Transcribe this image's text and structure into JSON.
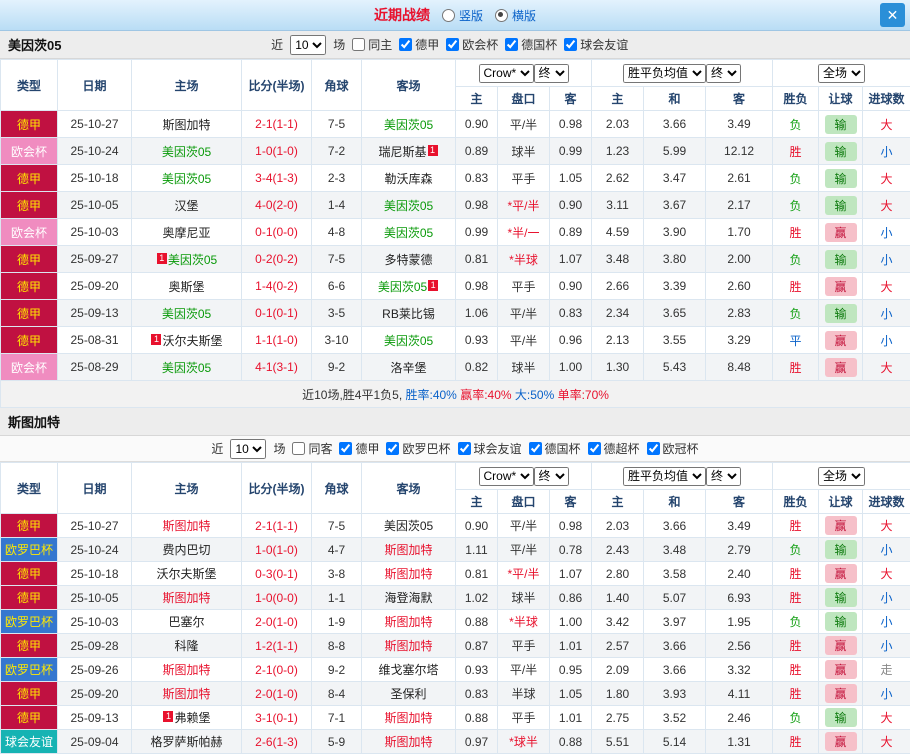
{
  "palette": {
    "title_red": "#e8112d",
    "link_blue": "#0a62c9",
    "team_green": "#0a9a0a",
    "team_red": "#e8112d",
    "league_bundesliga_bg": "#c01141",
    "league_conference_bg": "#f08cc0",
    "league_europa_bg": "#3577cf",
    "league_friendly_bg": "#16b3b3",
    "win_pill_bg": "#f6c0c9",
    "lose_pill_bg": "#bfe6bf",
    "titlebar_bg": "#b9ddf5",
    "close_btn_bg": "#2a8fd8"
  },
  "titlebar": {
    "title": "近期战绩",
    "radios": [
      {
        "label": "竖版",
        "checked": false
      },
      {
        "label": "横版",
        "checked": true
      }
    ],
    "close_glyph": "✕"
  },
  "table_header": {
    "left": [
      "类型",
      "日期",
      "主场",
      "比分(半场)",
      "角球",
      "客场"
    ],
    "odds_source": "Crow*",
    "final": "终",
    "avg_label": "胜平负均值",
    "scope": "全场",
    "sub": [
      "主",
      "盘口",
      "客",
      "主",
      "和",
      "客",
      "胜负",
      "让球",
      "进球数"
    ]
  },
  "sections": [
    {
      "team": "美因茨05",
      "filters_inline": true,
      "filters": {
        "near": "近",
        "count": "10",
        "unit": "场",
        "same": "同主",
        "same_checked": false,
        "leagues": [
          "德甲",
          "欧会杯",
          "德国杯",
          "球会友谊"
        ]
      },
      "rows": [
        {
          "lg": "德甲",
          "lgc": "dj",
          "date": "25-10-27",
          "home": {
            "name": "斯图加特"
          },
          "score": "2-1(1-1)",
          "corner": "7-5",
          "away": {
            "name": "美因茨05",
            "color": "green"
          },
          "oh": "0.90",
          "line": "平/半",
          "oa": "0.98",
          "eh": "2.03",
          "ed": "3.66",
          "ea": "3.49",
          "res": "负",
          "resc": "green",
          "let": "输",
          "letc": "lose",
          "goal": "大",
          "goalc": "red"
        },
        {
          "lg": "欧会杯",
          "lgc": "oh",
          "date": "25-10-24",
          "home": {
            "name": "美因茨05",
            "color": "green"
          },
          "score": "1-0(1-0)",
          "corner": "7-2",
          "away": {
            "name": "瑞尼斯基",
            "badge": "after",
            "badge_n": "1"
          },
          "oh": "0.89",
          "line": "球半",
          "oa": "0.99",
          "eh": "1.23",
          "ed": "5.99",
          "ea": "12.12",
          "res": "胜",
          "resc": "red",
          "let": "输",
          "letc": "lose",
          "goal": "小",
          "goalc": "blue"
        },
        {
          "lg": "德甲",
          "lgc": "dj",
          "date": "25-10-18",
          "home": {
            "name": "美因茨05",
            "color": "green"
          },
          "score": "3-4(1-3)",
          "corner": "2-3",
          "away": {
            "name": "勒沃库森"
          },
          "oh": "0.83",
          "line": "平手",
          "oa": "1.05",
          "eh": "2.62",
          "ed": "3.47",
          "ea": "2.61",
          "res": "负",
          "resc": "green",
          "let": "输",
          "letc": "lose",
          "goal": "大",
          "goalc": "red"
        },
        {
          "lg": "德甲",
          "lgc": "dj",
          "date": "25-10-05",
          "home": {
            "name": "汉堡"
          },
          "score": "4-0(2-0)",
          "corner": "1-4",
          "away": {
            "name": "美因茨05",
            "color": "green"
          },
          "oh": "0.98",
          "line": "*平/半",
          "lineRed": true,
          "oa": "0.90",
          "eh": "3.11",
          "ed": "3.67",
          "ea": "2.17",
          "res": "负",
          "resc": "green",
          "let": "输",
          "letc": "lose",
          "goal": "大",
          "goalc": "red"
        },
        {
          "lg": "欧会杯",
          "lgc": "oh",
          "date": "25-10-03",
          "home": {
            "name": "奥摩尼亚"
          },
          "score": "0-1(0-0)",
          "corner": "4-8",
          "away": {
            "name": "美因茨05",
            "color": "green"
          },
          "oh": "0.99",
          "line": "*半/一",
          "lineRed": true,
          "oa": "0.89",
          "eh": "4.59",
          "ed": "3.90",
          "ea": "1.70",
          "res": "胜",
          "resc": "red",
          "let": "赢",
          "letc": "win",
          "goal": "小",
          "goalc": "blue"
        },
        {
          "lg": "德甲",
          "lgc": "dj",
          "date": "25-09-27",
          "home": {
            "name": "美因茨05",
            "color": "green",
            "badge": "before",
            "badge_n": "1"
          },
          "score": "0-2(0-2)",
          "corner": "7-5",
          "away": {
            "name": "多特蒙德"
          },
          "oh": "0.81",
          "line": "*半球",
          "lineRed": true,
          "oa": "1.07",
          "eh": "3.48",
          "ed": "3.80",
          "ea": "2.00",
          "res": "负",
          "resc": "green",
          "let": "输",
          "letc": "lose",
          "goal": "小",
          "goalc": "blue"
        },
        {
          "lg": "德甲",
          "lgc": "dj",
          "date": "25-09-20",
          "home": {
            "name": "奥斯堡"
          },
          "score": "1-4(0-2)",
          "corner": "6-6",
          "away": {
            "name": "美因茨05",
            "color": "green",
            "badge": "after",
            "badge_n": "1"
          },
          "oh": "0.98",
          "line": "平手",
          "oa": "0.90",
          "eh": "2.66",
          "ed": "3.39",
          "ea": "2.60",
          "res": "胜",
          "resc": "red",
          "let": "赢",
          "letc": "win",
          "goal": "大",
          "goalc": "red"
        },
        {
          "lg": "德甲",
          "lgc": "dj",
          "date": "25-09-13",
          "home": {
            "name": "美因茨05",
            "color": "green"
          },
          "score": "0-1(0-1)",
          "corner": "3-5",
          "away": {
            "name": "RB莱比锡"
          },
          "oh": "1.06",
          "line": "平/半",
          "oa": "0.83",
          "eh": "2.34",
          "ed": "3.65",
          "ea": "2.83",
          "res": "负",
          "resc": "green",
          "let": "输",
          "letc": "lose",
          "goal": "小",
          "goalc": "blue"
        },
        {
          "lg": "德甲",
          "lgc": "dj",
          "date": "25-08-31",
          "home": {
            "name": "沃尔夫斯堡",
            "badge": "before",
            "badge_n": "1"
          },
          "score": "1-1(1-0)",
          "corner": "3-10",
          "away": {
            "name": "美因茨05",
            "color": "green"
          },
          "oh": "0.93",
          "line": "平/半",
          "oa": "0.96",
          "eh": "2.13",
          "ed": "3.55",
          "ea": "3.29",
          "res": "平",
          "resc": "blue",
          "let": "赢",
          "letc": "win",
          "goal": "小",
          "goalc": "blue"
        },
        {
          "lg": "欧会杯",
          "lgc": "oh",
          "date": "25-08-29",
          "home": {
            "name": "美因茨05",
            "color": "green"
          },
          "score": "4-1(3-1)",
          "corner": "9-2",
          "away": {
            "name": "洛辛堡"
          },
          "oh": "0.82",
          "line": "球半",
          "oa": "1.00",
          "eh": "1.30",
          "ed": "5.43",
          "ea": "8.48",
          "res": "胜",
          "resc": "red",
          "let": "赢",
          "letc": "win",
          "goal": "大",
          "goalc": "red"
        }
      ],
      "summary": [
        {
          "text": "近10场,胜4平1负5, ",
          "cls": "s-plain"
        },
        {
          "text": "胜率:40%",
          "cls": "s-blue"
        },
        {
          "text": " 赢率:40%",
          "cls": "s-red"
        },
        {
          "text": " 大:50%",
          "cls": "s-blue"
        },
        {
          "text": " 单率:70%",
          "cls": "s-red"
        }
      ]
    },
    {
      "team": "斯图加特",
      "filters_inline": false,
      "filters": {
        "near": "近",
        "count": "10",
        "unit": "场",
        "same": "同客",
        "same_checked": false,
        "leagues": [
          "德甲",
          "欧罗巴杯",
          "球会友谊",
          "德国杯",
          "德超杯",
          "欧冠杯"
        ]
      },
      "rows": [
        {
          "lg": "德甲",
          "lgc": "dj",
          "date": "25-10-27",
          "home": {
            "name": "斯图加特",
            "color": "red"
          },
          "score": "2-1(1-1)",
          "corner": "7-5",
          "away": {
            "name": "美因茨05"
          },
          "oh": "0.90",
          "line": "平/半",
          "oa": "0.98",
          "eh": "2.03",
          "ed": "3.66",
          "ea": "3.49",
          "res": "胜",
          "resc": "red",
          "let": "赢",
          "letc": "win",
          "goal": "大",
          "goalc": "red"
        },
        {
          "lg": "欧罗巴杯",
          "lgc": "ol",
          "date": "25-10-24",
          "home": {
            "name": "费内巴切"
          },
          "score": "1-0(1-0)",
          "corner": "4-7",
          "away": {
            "name": "斯图加特",
            "color": "red"
          },
          "oh": "1.11",
          "line": "平/半",
          "oa": "0.78",
          "eh": "2.43",
          "ed": "3.48",
          "ea": "2.79",
          "res": "负",
          "resc": "green",
          "let": "输",
          "letc": "lose",
          "goal": "小",
          "goalc": "blue"
        },
        {
          "lg": "德甲",
          "lgc": "dj",
          "date": "25-10-18",
          "home": {
            "name": "沃尔夫斯堡"
          },
          "score": "0-3(0-1)",
          "corner": "3-8",
          "away": {
            "name": "斯图加特",
            "color": "red"
          },
          "oh": "0.81",
          "line": "*平/半",
          "lineRed": true,
          "oa": "1.07",
          "eh": "2.80",
          "ed": "3.58",
          "ea": "2.40",
          "res": "胜",
          "resc": "red",
          "let": "赢",
          "letc": "win",
          "goal": "大",
          "goalc": "red"
        },
        {
          "lg": "德甲",
          "lgc": "dj",
          "date": "25-10-05",
          "home": {
            "name": "斯图加特",
            "color": "red"
          },
          "score": "1-0(0-0)",
          "corner": "1-1",
          "away": {
            "name": "海登海默"
          },
          "oh": "1.02",
          "line": "球半",
          "oa": "0.86",
          "eh": "1.40",
          "ed": "5.07",
          "ea": "6.93",
          "res": "胜",
          "resc": "red",
          "let": "输",
          "letc": "lose",
          "goal": "小",
          "goalc": "blue"
        },
        {
          "lg": "欧罗巴杯",
          "lgc": "ol",
          "date": "25-10-03",
          "home": {
            "name": "巴塞尔"
          },
          "score": "2-0(1-0)",
          "corner": "1-9",
          "away": {
            "name": "斯图加特",
            "color": "red"
          },
          "oh": "0.88",
          "line": "*半球",
          "lineRed": true,
          "oa": "1.00",
          "eh": "3.42",
          "ed": "3.97",
          "ea": "1.95",
          "res": "负",
          "resc": "green",
          "let": "输",
          "letc": "lose",
          "goal": "小",
          "goalc": "blue"
        },
        {
          "lg": "德甲",
          "lgc": "dj",
          "date": "25-09-28",
          "home": {
            "name": "科隆"
          },
          "score": "1-2(1-1)",
          "corner": "8-8",
          "away": {
            "name": "斯图加特",
            "color": "red"
          },
          "oh": "0.87",
          "line": "平手",
          "oa": "1.01",
          "eh": "2.57",
          "ed": "3.66",
          "ea": "2.56",
          "res": "胜",
          "resc": "red",
          "let": "赢",
          "letc": "win",
          "goal": "小",
          "goalc": "blue"
        },
        {
          "lg": "欧罗巴杯",
          "lgc": "ol",
          "date": "25-09-26",
          "home": {
            "name": "斯图加特",
            "color": "red"
          },
          "score": "2-1(0-0)",
          "corner": "9-2",
          "away": {
            "name": "维戈塞尔塔"
          },
          "oh": "0.93",
          "line": "平/半",
          "oa": "0.95",
          "eh": "2.09",
          "ed": "3.66",
          "ea": "3.32",
          "res": "胜",
          "resc": "red",
          "let": "赢",
          "letc": "win",
          "goal": "走",
          "goalc": "gray"
        },
        {
          "lg": "德甲",
          "lgc": "dj",
          "date": "25-09-20",
          "home": {
            "name": "斯图加特",
            "color": "red"
          },
          "score": "2-0(1-0)",
          "corner": "8-4",
          "away": {
            "name": "圣保利"
          },
          "oh": "0.83",
          "line": "半球",
          "oa": "1.05",
          "eh": "1.80",
          "ed": "3.93",
          "ea": "4.11",
          "res": "胜",
          "resc": "red",
          "let": "赢",
          "letc": "win",
          "goal": "小",
          "goalc": "blue"
        },
        {
          "lg": "德甲",
          "lgc": "dj",
          "date": "25-09-13",
          "home": {
            "name": "弗赖堡",
            "badge": "before",
            "badge_n": "1"
          },
          "score": "3-1(0-1)",
          "corner": "7-1",
          "away": {
            "name": "斯图加特",
            "color": "red"
          },
          "oh": "0.88",
          "line": "平手",
          "oa": "1.01",
          "eh": "2.75",
          "ed": "3.52",
          "ea": "2.46",
          "res": "负",
          "resc": "green",
          "let": "输",
          "letc": "lose",
          "goal": "大",
          "goalc": "red"
        },
        {
          "lg": "球会友谊",
          "lgc": "qy",
          "date": "25-09-04",
          "home": {
            "name": "格罗萨斯帕赫"
          },
          "score": "2-6(1-3)",
          "corner": "5-9",
          "away": {
            "name": "斯图加特",
            "color": "red"
          },
          "oh": "0.97",
          "line": "*球半",
          "lineRed": true,
          "oa": "0.88",
          "eh": "5.51",
          "ed": "5.14",
          "ea": "1.31",
          "res": "胜",
          "resc": "red",
          "let": "赢",
          "letc": "win",
          "goal": "大",
          "goalc": "red"
        }
      ]
    }
  ]
}
